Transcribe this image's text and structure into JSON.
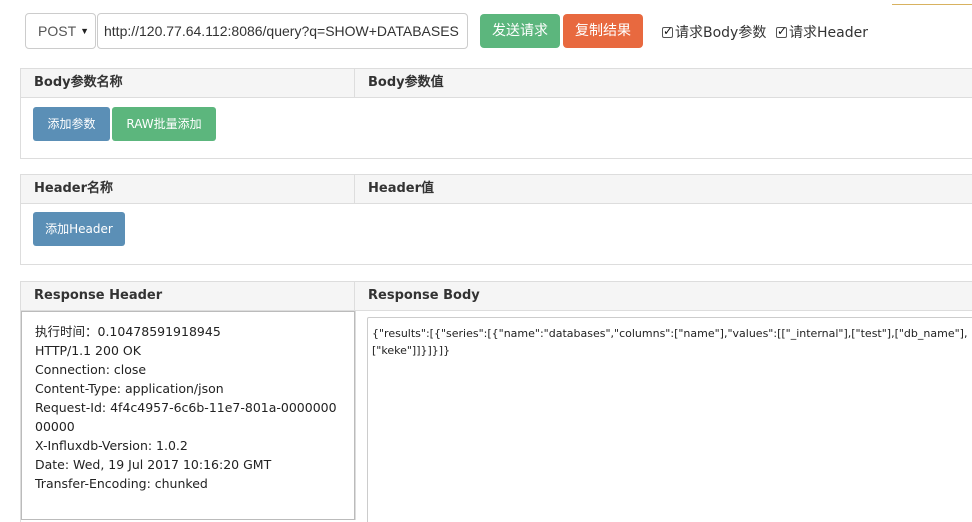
{
  "request": {
    "method": "POST",
    "url": "http://120.77.64.112:8086/query?q=SHOW+DATABASES",
    "send_label": "发送请求",
    "copy_label": "复制结果",
    "body_params_label": "请求Body参数",
    "header_label": "请求Header"
  },
  "body_panel": {
    "col_name": "Body参数名称",
    "col_value": "Body参数值",
    "add_param_label": "添加参数",
    "raw_batch_label": "RAW批量添加"
  },
  "header_panel": {
    "col_name": "Header名称",
    "col_value": "Header值",
    "add_header_label": "添加Header"
  },
  "response": {
    "header_title": "Response Header",
    "body_title": "Response Body",
    "header_lines": [
      "执行时间：0.10478591918945",
      "HTTP/1.1 200 OK",
      "Connection: close",
      "Content-Type: application/json",
      "Request-Id: 4f4c4957-6c6b-11e7-801a-000000000000",
      "X-Influxdb-Version: 1.0.2",
      "Date: Wed, 19 Jul 2017 10:16:20 GMT",
      "Transfer-Encoding: chunked"
    ],
    "body_text": "{\"results\":[{\"series\":[{\"name\":\"databases\",\"columns\":[\"name\"],\"values\":[[\"_internal\"],[\"test\"],[\"db_name\"],[\"keke\"]]}]}]}"
  },
  "colors": {
    "send_button": "#5cb67d",
    "copy_button": "#e8693f",
    "primary_button": "#5b8fb6"
  }
}
